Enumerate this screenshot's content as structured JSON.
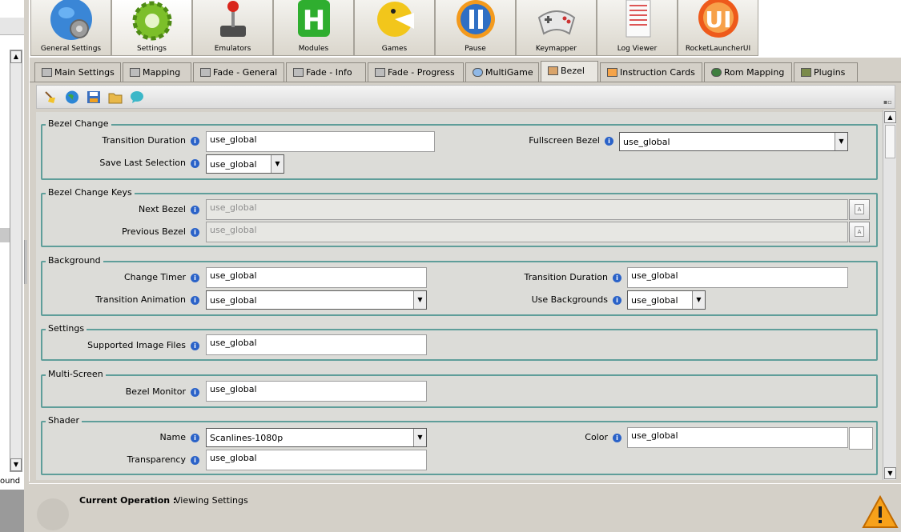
{
  "left_panel": {
    "partial_text": "ound"
  },
  "top_tabs": [
    {
      "label": "General Settings"
    },
    {
      "label": "Settings"
    },
    {
      "label": "Emulators"
    },
    {
      "label": "Modules"
    },
    {
      "label": "Games"
    },
    {
      "label": "Pause"
    },
    {
      "label": "Keymapper"
    },
    {
      "label": "Log Viewer"
    },
    {
      "label": "RocketLauncherUI"
    }
  ],
  "tabs": [
    {
      "label": "Main Settings"
    },
    {
      "label": "Mapping"
    },
    {
      "label": "Fade - General"
    },
    {
      "label": "Fade - Info"
    },
    {
      "label": "Fade - Progress"
    },
    {
      "label": "MultiGame"
    },
    {
      "label": "Bezel"
    },
    {
      "label": "Instruction Cards"
    },
    {
      "label": "Rom Mapping"
    },
    {
      "label": "Plugins"
    }
  ],
  "groups": {
    "bezel_change": {
      "title": "Bezel Change",
      "transition_duration": {
        "label": "Transition Duration",
        "value": "use_global"
      },
      "fullscreen_bezel": {
        "label": "Fullscreen Bezel",
        "value": "use_global"
      },
      "save_last_selection": {
        "label": "Save Last Selection",
        "value": "use_global"
      }
    },
    "bezel_change_keys": {
      "title": "Bezel Change Keys",
      "next_bezel": {
        "label": "Next Bezel",
        "value": "use_global"
      },
      "previous_bezel": {
        "label": "Previous Bezel",
        "value": "use_global"
      }
    },
    "background": {
      "title": "Background",
      "change_timer": {
        "label": "Change Timer",
        "value": "use_global"
      },
      "transition_duration": {
        "label": "Transition Duration",
        "value": "use_global"
      },
      "transition_animation": {
        "label": "Transition Animation",
        "value": "use_global"
      },
      "use_backgrounds": {
        "label": "Use Backgrounds",
        "value": "use_global"
      }
    },
    "settings": {
      "title": "Settings",
      "supported_image_files": {
        "label": "Supported Image Files",
        "value": "use_global"
      }
    },
    "multi_screen": {
      "title": "Multi-Screen",
      "bezel_monitor": {
        "label": "Bezel Monitor",
        "value": "use_global"
      }
    },
    "shader": {
      "title": "Shader",
      "name": {
        "label": "Name",
        "value": "Scanlines-1080p"
      },
      "color": {
        "label": "Color",
        "value": "use_global"
      },
      "transparency": {
        "label": "Transparency",
        "value": "use_global"
      }
    }
  },
  "status": {
    "label": "Current Operation :",
    "value": "Viewing Settings"
  },
  "colors": {
    "group_border": "#5f9e9a",
    "info_icon": "#2a62c8",
    "warning": "#f7a11a"
  }
}
